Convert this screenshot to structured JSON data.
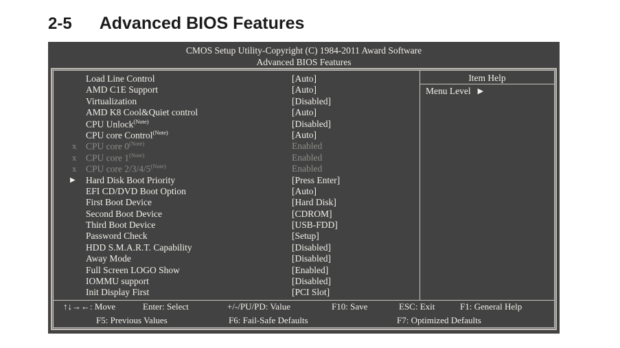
{
  "manual": {
    "section_number": "2-5",
    "section_title": "Advanced BIOS Features"
  },
  "bios": {
    "titlebar_line1": "CMOS Setup Utility-Copyright (C) 1984-2011 Award Software",
    "titlebar_line2": "Advanced BIOS Features",
    "colors": {
      "screen_background": "#424242",
      "active_text": "#f2f0ea",
      "disabled_text": "#8e8d89",
      "border": "#c9c7c0"
    },
    "options": [
      {
        "marker": "",
        "label": "Load Line Control",
        "note": "",
        "value": "[Auto]",
        "enabled": true
      },
      {
        "marker": "",
        "label": "AMD C1E Support",
        "note": "",
        "value": "[Auto]",
        "enabled": true
      },
      {
        "marker": "",
        "label": "Virtualization",
        "note": "",
        "value": "[Disabled]",
        "enabled": true
      },
      {
        "marker": "",
        "label": "AMD K8 Cool&Quiet control",
        "note": "",
        "value": "[Auto]",
        "enabled": true
      },
      {
        "marker": "",
        "label": "CPU Unlock",
        "note": "(Note)",
        "value": "[Disabled]",
        "enabled": true
      },
      {
        "marker": "",
        "label": "CPU core Control",
        "note": "(Note)",
        "value": "[Auto]",
        "enabled": true
      },
      {
        "marker": "x",
        "label": "CPU core 0",
        "note": "(Note)",
        "value": "Enabled",
        "enabled": false
      },
      {
        "marker": "x",
        "label": "CPU core 1",
        "note": "(Note)",
        "value": "Enabled",
        "enabled": false
      },
      {
        "marker": "x",
        "label": "CPU core 2/3/4/5",
        "note": "(Note)",
        "value": "Enabled",
        "enabled": false
      },
      {
        "marker": "▶",
        "label": "Hard Disk Boot Priority",
        "note": "",
        "value": "[Press Enter]",
        "enabled": true
      },
      {
        "marker": "",
        "label": "EFI CD/DVD Boot Option",
        "note": "",
        "value": "[Auto]",
        "enabled": true
      },
      {
        "marker": "",
        "label": "First Boot Device",
        "note": "",
        "value": "[Hard Disk]",
        "enabled": true
      },
      {
        "marker": "",
        "label": "Second Boot Device",
        "note": "",
        "value": "[CDROM]",
        "enabled": true
      },
      {
        "marker": "",
        "label": "Third Boot Device",
        "note": "",
        "value": "[USB-FDD]",
        "enabled": true
      },
      {
        "marker": "",
        "label": "Password Check",
        "note": "",
        "value": "[Setup]",
        "enabled": true
      },
      {
        "marker": "",
        "label": "HDD S.M.A.R.T. Capability",
        "note": "",
        "value": "[Disabled]",
        "enabled": true
      },
      {
        "marker": "",
        "label": "Away Mode",
        "note": "",
        "value": "[Disabled]",
        "enabled": true
      },
      {
        "marker": "",
        "label": "Full Screen LOGO Show",
        "note": "",
        "value": "[Enabled]",
        "enabled": true
      },
      {
        "marker": "",
        "label": "IOMMU support",
        "note": "",
        "value": "[Disabled]",
        "enabled": true
      },
      {
        "marker": "",
        "label": "Init Display First",
        "note": "",
        "value": "[PCI Slot]",
        "enabled": true
      }
    ],
    "item_help": {
      "title": "Item Help",
      "menu_level_label": "Menu Level",
      "menu_level_arrow": "▶"
    },
    "footer": {
      "move": "↑↓→←: Move",
      "enter": "Enter: Select",
      "value": "+/-/PU/PD: Value",
      "save": "F10: Save",
      "esc": "ESC: Exit",
      "general_help": "F1: General Help",
      "previous_values": "F5: Previous Values",
      "fail_safe": "F6: Fail-Safe Defaults",
      "optimized": "F7: Optimized Defaults"
    }
  }
}
